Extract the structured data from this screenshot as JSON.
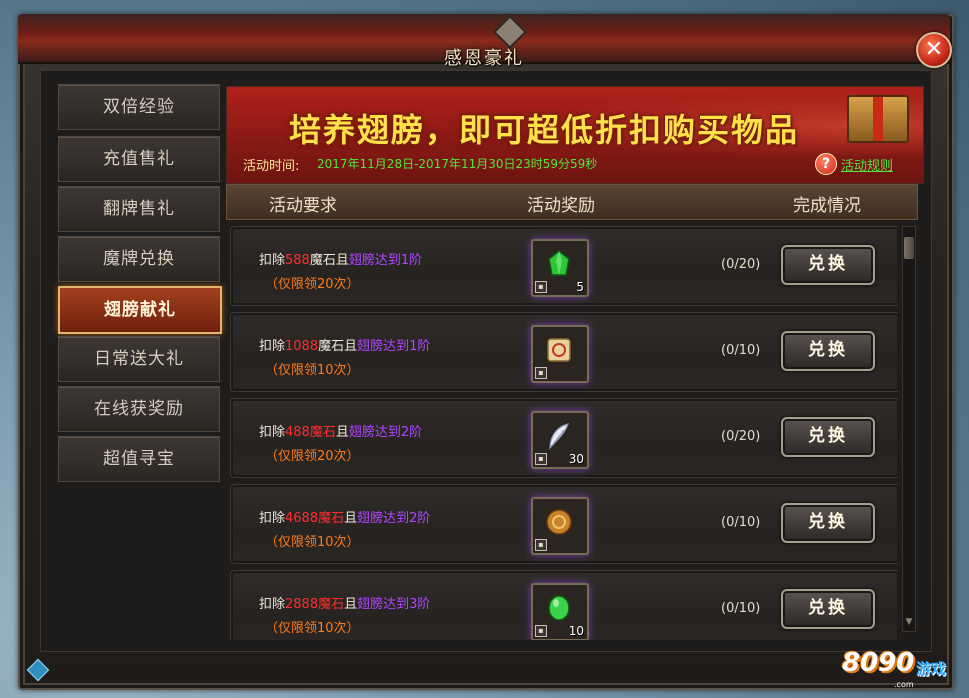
{
  "window": {
    "title": "感恩豪礼",
    "close_label": "✕"
  },
  "sidebar": {
    "items": [
      {
        "label": "双倍经验",
        "active": false
      },
      {
        "label": "充值售礼",
        "active": false
      },
      {
        "label": "翻牌售礼",
        "active": false
      },
      {
        "label": "魔牌兑换",
        "active": false
      },
      {
        "label": "翅膀献礼",
        "active": true
      },
      {
        "label": "日常送大礼",
        "active": false
      },
      {
        "label": "在线获奖励",
        "active": false
      },
      {
        "label": "超值寻宝",
        "active": false
      }
    ]
  },
  "banner": {
    "slogan": "培养翅膀，即可超低折扣购买物品",
    "time_label": "活动时间:",
    "time_value": "2017年11月28日-2017年11月30日23时59分59秒",
    "rules_icon": "?",
    "rules_label": "活动规则"
  },
  "table": {
    "headers": [
      "活动要求",
      "活动奖励",
      "完成情况"
    ],
    "rows": [
      {
        "prefix": "扣除",
        "amount": "588",
        "currency": "魔石",
        "and": "且",
        "condition": "翅膀达到1阶",
        "limit": "（仅限领20次）",
        "item_icon": "green-gem-icon",
        "item_count": "5",
        "progress": "(0/20)",
        "button": "兑换"
      },
      {
        "prefix": "扣除",
        "amount": "1088",
        "currency": "魔石",
        "and": "且",
        "condition": "翅膀达到1阶",
        "limit": "（仅限领10次）",
        "item_icon": "scroll-icon",
        "item_count": "",
        "progress": "(0/10)",
        "button": "兑换"
      },
      {
        "prefix": "扣除",
        "amount": "488",
        "currency": "魔石",
        "and": "且",
        "condition": "翅膀达到2阶",
        "limit": "（仅限领20次）",
        "item_icon": "feather-icon",
        "item_count": "30",
        "progress": "(0/20)",
        "button": "兑换"
      },
      {
        "prefix": "扣除",
        "amount": "4688",
        "currency": "魔石",
        "and": "且",
        "condition": "翅膀达到2阶",
        "limit": "（仅限领10次）",
        "item_icon": "gold-coin-icon",
        "item_count": "",
        "progress": "(0/10)",
        "button": "兑换"
      },
      {
        "prefix": "扣除",
        "amount": "2888",
        "currency": "魔石",
        "and": "且",
        "condition": "翅膀达到3阶",
        "limit": "（仅限领10次）",
        "item_icon": "emerald-icon",
        "item_count": "10",
        "progress": "(0/10)",
        "button": "兑换"
      }
    ]
  },
  "watermark": {
    "number": "8090",
    "brand": "游戏",
    "domain": ".com"
  },
  "colors": {
    "amount_red": "#ff2d2d",
    "condition_purple": "#b046ff",
    "limit_orange": "#ff7a1a",
    "time_green": "#51e53b",
    "slogan_yellow": "#ffe14a"
  }
}
